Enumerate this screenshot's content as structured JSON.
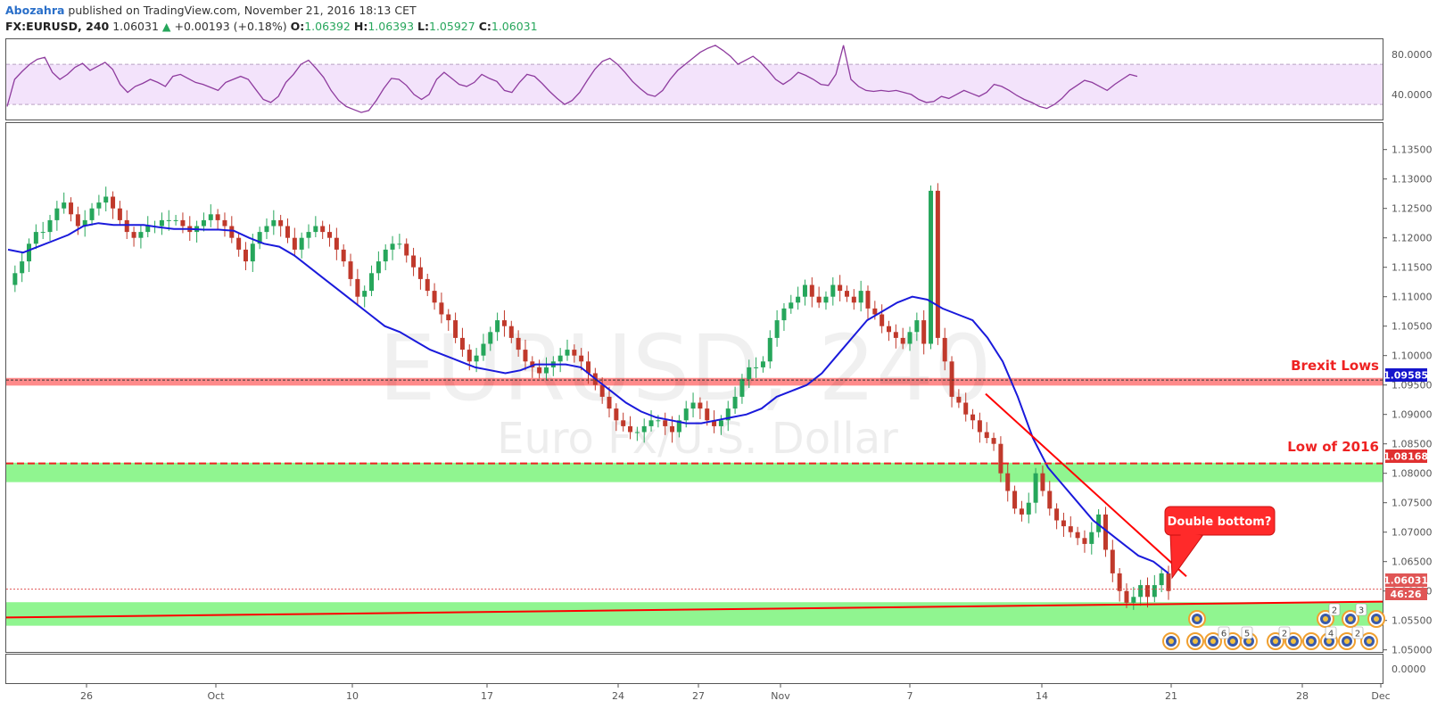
{
  "header": {
    "author": "Abozahra",
    "published_text": "published on TradingView.com, November 21, 2016 18:13 CET",
    "symbol": "FX:EURUSD, 240",
    "last": "1.06031",
    "up_arrow": "▲",
    "change": "+0.00193 (+0.18%)",
    "open_label": "O:",
    "open": "1.06392",
    "high_label": "H:",
    "high": "1.06393",
    "low_label": "L:",
    "low": "1.05927",
    "close_label": "C:",
    "close": "1.06031"
  },
  "watermark": {
    "symbol": "EURUSD, 240",
    "name": "Euro Fx/U.S. Dollar"
  },
  "colors": {
    "up": "#26a65b",
    "down": "#c0392b",
    "ma": "#1a1adb",
    "rsi": "#8e3b9e",
    "rsi_band": "#f3e3fb",
    "resistance": "#ff8a8a",
    "support": "#90f590",
    "trendline": "#ff0000"
  },
  "chart_data": [
    {
      "type": "line",
      "panel": "RSI",
      "y_ticks": [
        "80.0000",
        "40.0000"
      ],
      "band": [
        30,
        70
      ],
      "ylim": [
        15,
        95
      ],
      "values": [
        28,
        55,
        63,
        70,
        75,
        77,
        62,
        55,
        60,
        67,
        71,
        64,
        68,
        72,
        65,
        50,
        42,
        48,
        51,
        55,
        52,
        48,
        58,
        60,
        56,
        52,
        50,
        47,
        44,
        52,
        55,
        58,
        55,
        45,
        35,
        32,
        38,
        52,
        60,
        70,
        74,
        66,
        57,
        44,
        34,
        28,
        25,
        22,
        24,
        34,
        46,
        56,
        55,
        49,
        40,
        35,
        40,
        55,
        62,
        56,
        50,
        48,
        52,
        60,
        56,
        53,
        44,
        42,
        52,
        60,
        58,
        51,
        43,
        36,
        30,
        34,
        42,
        54,
        65,
        73,
        76,
        70,
        62,
        53,
        46,
        40,
        38,
        44,
        55,
        64,
        70,
        76,
        82,
        86,
        89,
        84,
        78,
        70,
        74,
        78,
        72,
        64,
        55,
        50,
        55,
        62,
        59,
        55,
        50,
        49,
        60,
        89,
        55,
        48,
        44,
        43,
        44,
        43,
        44,
        42,
        40,
        35,
        32,
        33,
        38,
        36,
        40,
        44,
        41,
        38,
        42,
        50,
        48,
        44,
        39,
        35,
        32,
        28,
        26,
        30,
        36,
        44,
        49,
        54,
        52,
        48,
        44,
        50,
        55,
        60,
        58
      ],
      "latest": 52
    },
    {
      "type": "candlestick",
      "panel": "price",
      "y_ticks": [
        "1.13500",
        "1.13000",
        "1.12500",
        "1.12000",
        "1.11500",
        "1.11000",
        "1.10500",
        "1.10000",
        "1.09500",
        "1.09000",
        "1.08500",
        "1.08000",
        "1.07500",
        "1.07000",
        "1.06500",
        "1.06000",
        "1.05500",
        "1.05000"
      ],
      "y_tick_values": [
        1.135,
        1.13,
        1.125,
        1.12,
        1.115,
        1.11,
        1.105,
        1.1,
        1.095,
        1.09,
        1.085,
        1.08,
        1.075,
        1.07,
        1.065,
        1.06,
        1.055,
        1.05
      ],
      "ylim": [
        1.0495,
        1.1395
      ],
      "x_ticks": [
        "26",
        "Oct",
        "10",
        "17",
        "24",
        "27",
        "Nov",
        "7",
        "14",
        "21",
        "28",
        "Dec"
      ],
      "series_close": [
        1.112,
        1.114,
        1.116,
        1.119,
        1.121,
        1.121,
        1.123,
        1.125,
        1.126,
        1.124,
        1.122,
        1.123,
        1.125,
        1.126,
        1.127,
        1.125,
        1.123,
        1.121,
        1.12,
        1.121,
        1.122,
        1.122,
        1.123,
        1.123,
        1.123,
        1.122,
        1.121,
        1.122,
        1.123,
        1.124,
        1.123,
        1.122,
        1.12,
        1.118,
        1.116,
        1.119,
        1.121,
        1.122,
        1.123,
        1.122,
        1.12,
        1.118,
        1.12,
        1.121,
        1.122,
        1.121,
        1.12,
        1.118,
        1.116,
        1.113,
        1.11,
        1.111,
        1.114,
        1.116,
        1.118,
        1.119,
        1.119,
        1.117,
        1.115,
        1.113,
        1.111,
        1.109,
        1.107,
        1.106,
        1.103,
        1.101,
        1.099,
        1.1,
        1.102,
        1.104,
        1.106,
        1.105,
        1.103,
        1.101,
        1.099,
        1.098,
        1.097,
        1.098,
        1.099,
        1.1,
        1.101,
        1.1,
        1.099,
        1.097,
        1.095,
        1.093,
        1.091,
        1.089,
        1.088,
        1.087,
        1.087,
        1.088,
        1.089,
        1.089,
        1.088,
        1.087,
        1.089,
        1.091,
        1.092,
        1.091,
        1.089,
        1.088,
        1.089,
        1.091,
        1.093,
        1.096,
        1.098,
        1.098,
        1.099,
        1.103,
        1.106,
        1.108,
        1.109,
        1.11,
        1.112,
        1.11,
        1.109,
        1.11,
        1.112,
        1.111,
        1.11,
        1.109,
        1.111,
        1.108,
        1.107,
        1.105,
        1.104,
        1.103,
        1.102,
        1.104,
        1.106,
        1.102,
        1.128,
        1.103,
        1.099,
        1.093,
        1.092,
        1.09,
        1.089,
        1.087,
        1.086,
        1.085,
        1.08,
        1.077,
        1.074,
        1.073,
        1.075,
        1.08,
        1.077,
        1.074,
        1.072,
        1.071,
        1.07,
        1.069,
        1.068,
        1.07,
        1.073,
        1.067,
        1.063,
        1.06,
        1.058,
        1.059,
        1.061,
        1.059,
        1.061,
        1.063,
        1.06
      ],
      "moving_average": [
        1.118,
        1.1175,
        1.1185,
        1.1195,
        1.1205,
        1.122,
        1.1225,
        1.1222,
        1.1222,
        1.1222,
        1.1218,
        1.1215,
        1.1215,
        1.1214,
        1.1214,
        1.1212,
        1.12,
        1.119,
        1.1185,
        1.117,
        1.115,
        1.113,
        1.111,
        1.109,
        1.107,
        1.105,
        1.104,
        1.1025,
        1.101,
        1.1,
        1.099,
        1.098,
        1.0975,
        1.097,
        1.0975,
        1.0985,
        1.0985,
        1.0985,
        1.098,
        1.096,
        1.094,
        1.092,
        1.0905,
        1.0895,
        1.089,
        1.0885,
        1.0885,
        1.089,
        1.0895,
        1.09,
        1.091,
        1.093,
        1.094,
        1.095,
        1.097,
        1.1,
        1.103,
        1.106,
        1.1075,
        1.109,
        1.11,
        1.1095,
        1.108,
        1.107,
        1.106,
        1.103,
        1.099,
        1.093,
        1.086,
        1.081,
        1.078,
        1.075,
        1.072,
        1.07,
        1.068,
        1.066,
        1.065,
        1.063
      ],
      "annotations": [
        {
          "label": "Brexit Lows",
          "price": "1.09585",
          "price_value": 1.09585
        },
        {
          "label": "Low of 2016",
          "price": "1.08168",
          "price_value": 1.08168
        },
        {
          "label": "Double bottom?"
        }
      ],
      "support_zones": [
        [
          1.0785,
          1.0818
        ],
        [
          1.0541,
          1.0581
        ]
      ],
      "resistance_zone": [
        1.0949,
        1.0962
      ],
      "last_price": "1.06031",
      "last_price_value": 1.06031,
      "countdown": "46:26",
      "lower_panel_tick": "0.0000"
    }
  ],
  "event_markers": {
    "badges": [
      "2",
      "3",
      "6",
      "5",
      "2",
      "4",
      "2"
    ]
  }
}
